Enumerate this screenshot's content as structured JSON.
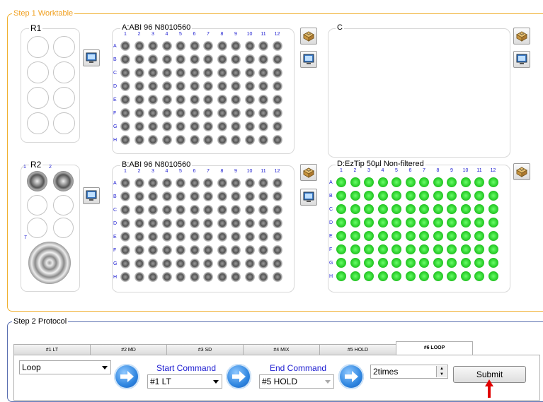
{
  "step1": {
    "legend": "Step 1 Worktable",
    "r1": {
      "title": "R1"
    },
    "r2": {
      "title": "R2",
      "num1": "1",
      "num2": "2",
      "num7": "7"
    },
    "plate_a": {
      "title": "A:ABI 96 N8010560"
    },
    "plate_b": {
      "title": "B:ABI 96 N8010560"
    },
    "plate_c": {
      "title": "C"
    },
    "plate_d": {
      "title": "D:EzTip 50µl Non-filtered"
    },
    "columns": [
      "1",
      "2",
      "3",
      "4",
      "5",
      "6",
      "7",
      "8",
      "9",
      "10",
      "11",
      "12"
    ],
    "rows": [
      "A",
      "B",
      "C",
      "D",
      "E",
      "F",
      "G",
      "H"
    ],
    "well_colors": {
      "gray": "#6c6c6c",
      "green": "#2dd02d"
    }
  },
  "step2": {
    "legend": "Step 2 Protocol",
    "tabs": [
      "#1 LT",
      "#2 MD",
      "#3 SD",
      "#4 MIX",
      "#5 HOLD",
      "#6 LOOP"
    ],
    "active_tab": "#6 LOOP",
    "type_combo": "Loop",
    "start_label": "Start Command",
    "start_value": "#1 LT",
    "end_label": "End Command",
    "end_value": "#5 HOLD",
    "times_value": "2times",
    "submit_label": "Submit"
  },
  "colors": {
    "accent": "#f0b030",
    "label_blue": "#1a1ad0",
    "pointer": "#e00000"
  },
  "icons": [
    "monitor-icon",
    "pipette-box-icon",
    "arrow-right-icon",
    "dropdown-arrow-icon",
    "pointer-arrow-icon"
  ]
}
